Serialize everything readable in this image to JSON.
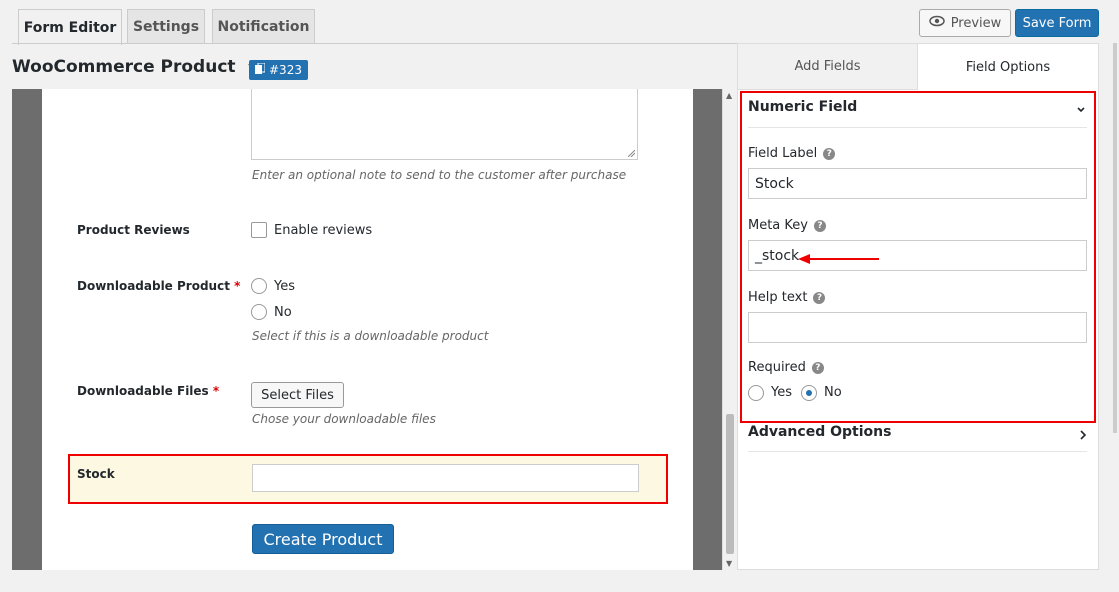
{
  "tabs": [
    {
      "label": "Form Editor",
      "active": true
    },
    {
      "label": "Settings",
      "active": false
    },
    {
      "label": "Notification",
      "active": false
    }
  ],
  "actions": {
    "preview_label": "Preview",
    "save_label": "Save Form"
  },
  "form": {
    "title": "WooCommerce Product",
    "id_badge": "#323"
  },
  "canvas": {
    "note_help": "Enter an optional note to send to the customer after purchase",
    "reviews": {
      "label": "Product Reviews",
      "checkbox_label": "Enable reviews"
    },
    "downloadable": {
      "label": "Downloadable Product",
      "required": "*",
      "options": [
        "Yes",
        "No"
      ],
      "help": "Select if this is a downloadable product"
    },
    "files": {
      "label": "Downloadable Files",
      "required": "*",
      "button": "Select Files",
      "help": "Chose your downloadable files"
    },
    "stock": {
      "label": "Stock",
      "value": ""
    },
    "submit": "Create Product"
  },
  "panel": {
    "tabs": [
      "Add Fields",
      "Field Options"
    ],
    "active_tab": "Field Options",
    "section_title": "Numeric Field",
    "field_label": {
      "label": "Field Label",
      "value": "Stock"
    },
    "meta_key": {
      "label": "Meta Key",
      "value": "_stock"
    },
    "help_text": {
      "label": "Help text",
      "value": ""
    },
    "required": {
      "label": "Required",
      "options": [
        "Yes",
        "No"
      ],
      "selected": "No"
    },
    "advanced": "Advanced Options"
  },
  "colors": {
    "accent": "#2271b1",
    "highlight": "#e00000",
    "stock_bg": "#fdf8e2"
  }
}
